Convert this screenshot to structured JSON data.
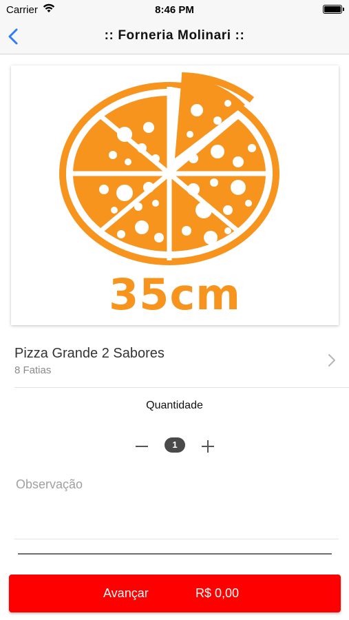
{
  "status_bar": {
    "carrier": "Carrier",
    "time": "8:46 PM"
  },
  "nav": {
    "title": ":: Forneria Molinari ::",
    "back_icon": "chevron-left-icon",
    "accent_color": "#2f7cf6"
  },
  "product": {
    "image": {
      "icon": "pizza-icon",
      "size_label": "35cm",
      "color": "#f7941d"
    },
    "name": "Pizza Grande 2 Sabores",
    "subtitle": "8 Fatias",
    "detail_icon": "chevron-right-icon"
  },
  "quantity": {
    "label": "Quantidade",
    "value": "1",
    "decrement_icon": "minus-icon",
    "increment_icon": "plus-icon"
  },
  "observation": {
    "placeholder": "Observação",
    "value": ""
  },
  "footer": {
    "advance_label": "Avançar",
    "price": "R$ 0,00",
    "button_color": "#ff0000"
  }
}
